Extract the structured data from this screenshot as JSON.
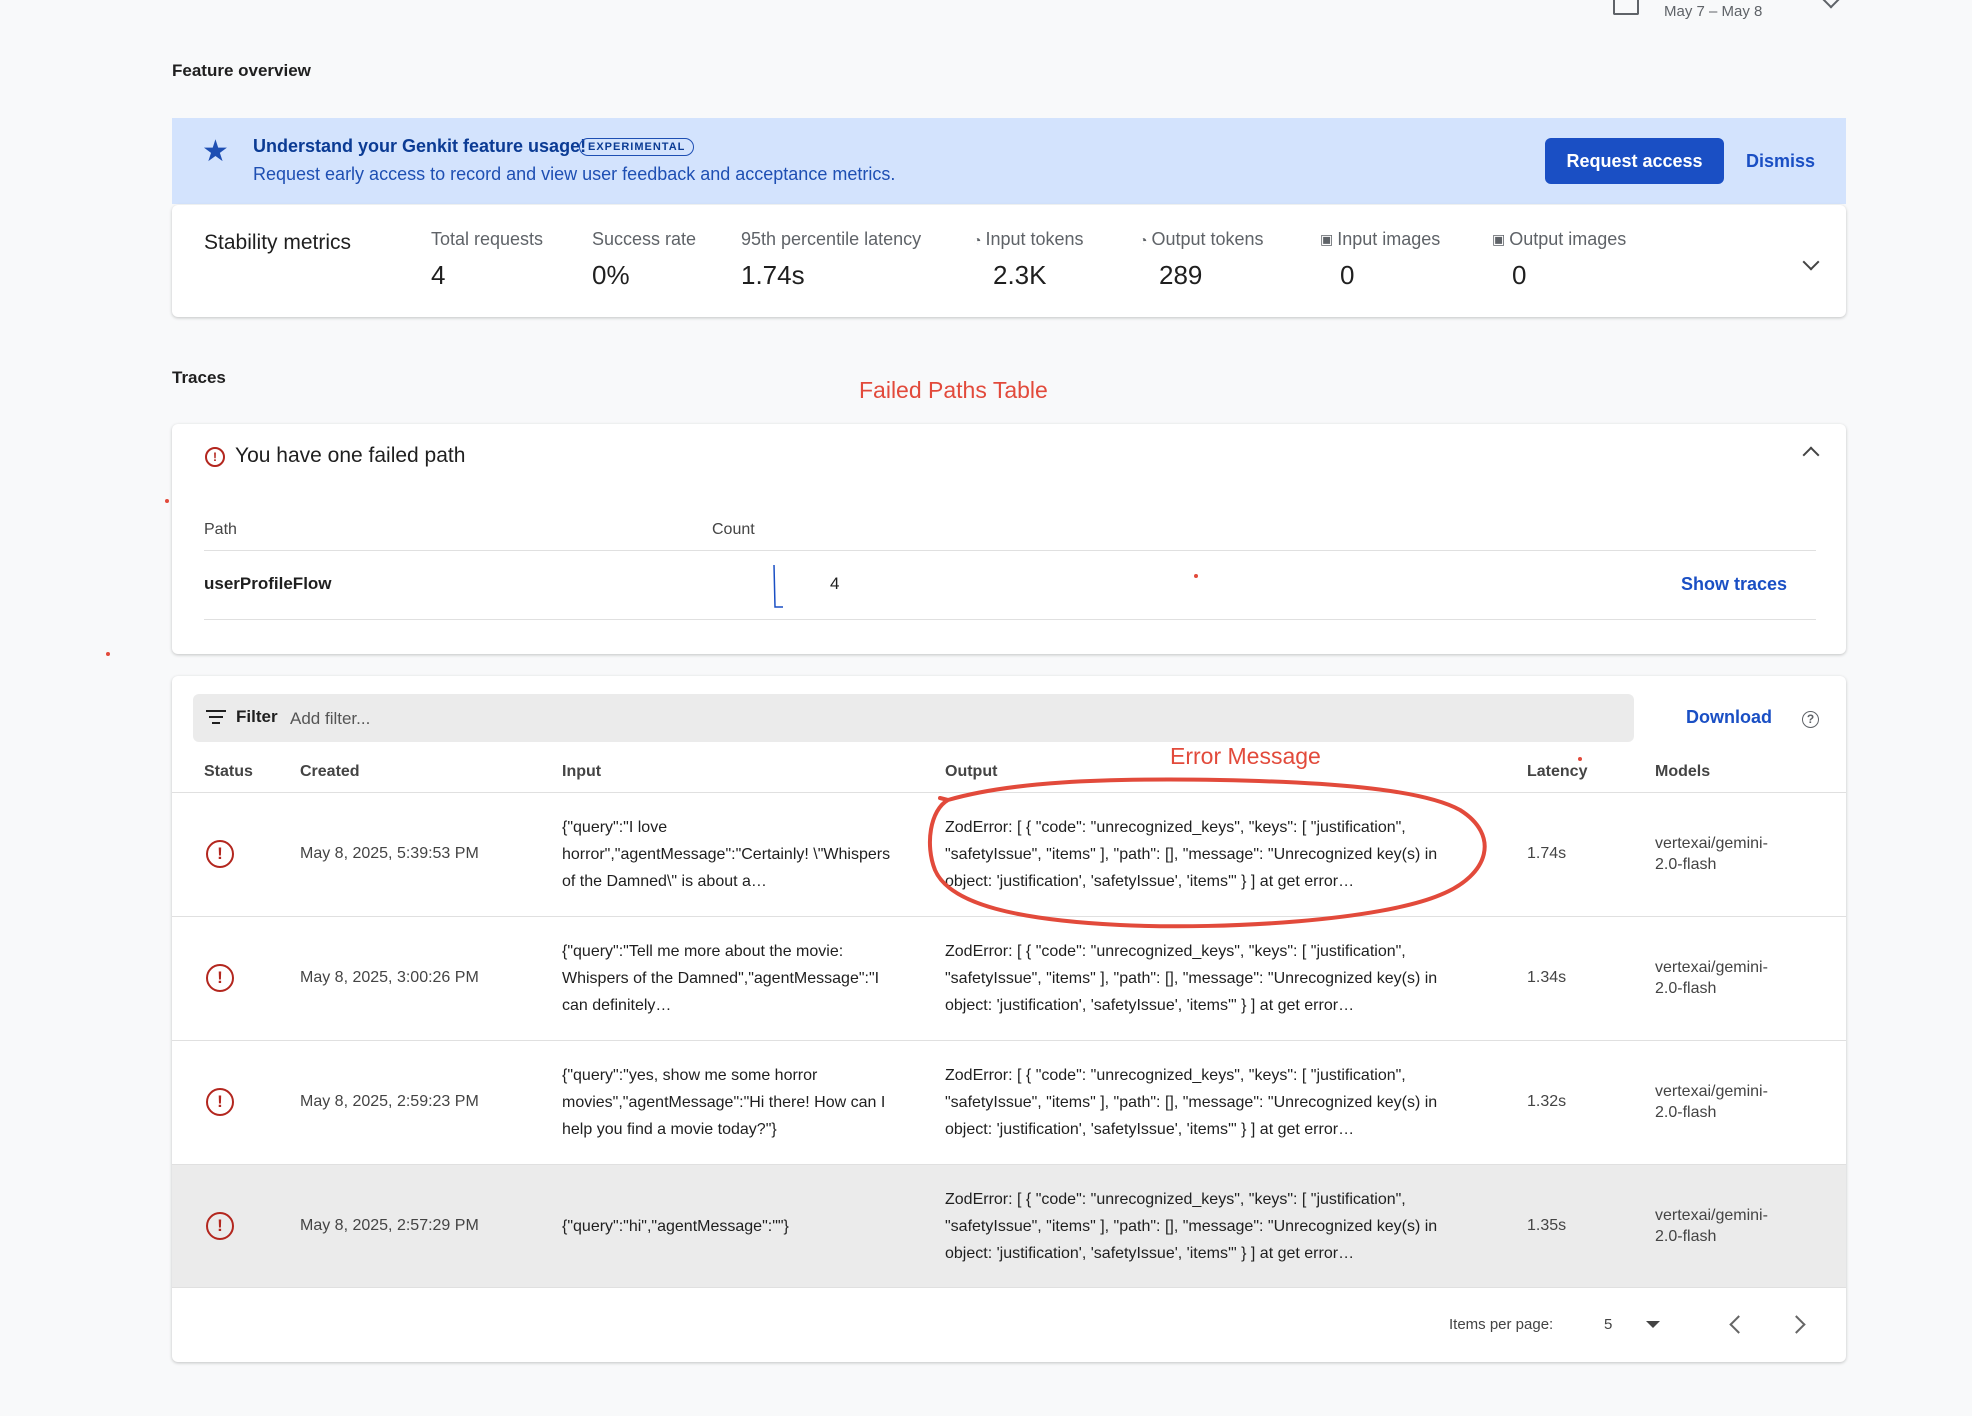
{
  "date_range": {
    "text": "May 7 – May 8"
  },
  "feature_overview": {
    "title": "Feature overview"
  },
  "banner": {
    "title": "Understand your Genkit feature usage!",
    "badge": "EXPERIMENTAL",
    "subtitle": "Request early access to record and view user feedback and acceptance metrics.",
    "request_label": "Request access",
    "dismiss_label": "Dismiss"
  },
  "stability": {
    "title": "Stability metrics",
    "metrics": [
      {
        "label": "Total requests",
        "value": "4",
        "icon": ""
      },
      {
        "label": "Success rate",
        "value": "0%",
        "icon": ""
      },
      {
        "label": "95th percentile latency",
        "value": "1.74s",
        "icon": ""
      },
      {
        "label": "Input tokens",
        "value": "2.3K",
        "icon": "token-icon"
      },
      {
        "label": "Output tokens",
        "value": "289",
        "icon": "token-icon"
      },
      {
        "label": "Input images",
        "value": "0",
        "icon": "image-icon"
      },
      {
        "label": "Output images",
        "value": "0",
        "icon": "image-icon"
      }
    ]
  },
  "traces": {
    "title": "Traces"
  },
  "annotations": {
    "failed_paths": "Failed Paths Table",
    "error_message": "Error Message"
  },
  "failed_paths": {
    "title": "You have one failed path",
    "col_path": "Path",
    "col_count": "Count",
    "rows": [
      {
        "path": "userProfileFlow",
        "count": "4",
        "action": "Show traces"
      }
    ]
  },
  "traces_table": {
    "filter_label": "Filter",
    "filter_placeholder": "Add filter...",
    "download_label": "Download",
    "columns": {
      "status": "Status",
      "created": "Created",
      "input": "Input",
      "output": "Output",
      "latency": "Latency",
      "models": "Models"
    },
    "rows": [
      {
        "created": "May 8, 2025, 5:39:53 PM",
        "input": "{\"query\":\"I love horror\",\"agentMessage\":\"Certainly! \\\"Whispers of the Damned\\\" is about a…",
        "output": "ZodError: [ { \"code\": \"unrecognized_keys\", \"keys\": [ \"justification\", \"safetyIssue\", \"items\" ], \"path\": [], \"message\": \"Unrecognized key(s) in object: 'justification', 'safetyIssue', 'items'\" } ] at get error…",
        "latency": "1.74s",
        "model": "vertexai/gemini-2.0-flash"
      },
      {
        "created": "May 8, 2025, 3:00:26 PM",
        "input": "{\"query\":\"Tell me more about the movie: Whispers of the Damned\",\"agentMessage\":\"I can definitely…",
        "output": "ZodError: [ { \"code\": \"unrecognized_keys\", \"keys\": [ \"justification\", \"safetyIssue\", \"items\" ], \"path\": [], \"message\": \"Unrecognized key(s) in object: 'justification', 'safetyIssue', 'items'\" } ] at get error…",
        "latency": "1.34s",
        "model": "vertexai/gemini-2.0-flash"
      },
      {
        "created": "May 8, 2025, 2:59:23 PM",
        "input": "{\"query\":\"yes, show me some horror movies\",\"agentMessage\":\"Hi there! How can I help you find a movie today?\"}",
        "output": "ZodError: [ { \"code\": \"unrecognized_keys\", \"keys\": [ \"justification\", \"safetyIssue\", \"items\" ], \"path\": [], \"message\": \"Unrecognized key(s) in object: 'justification', 'safetyIssue', 'items'\" } ] at get error…",
        "latency": "1.32s",
        "model": "vertexai/gemini-2.0-flash"
      },
      {
        "created": "May 8, 2025, 2:57:29 PM",
        "input": "{\"query\":\"hi\",\"agentMessage\":\"\"}",
        "output": "ZodError: [ { \"code\": \"unrecognized_keys\", \"keys\": [ \"justification\", \"safetyIssue\", \"items\" ], \"path\": [], \"message\": \"Unrecognized key(s) in object: 'justification', 'safetyIssue', 'items'\" } ] at get error…",
        "latency": "1.35s",
        "model": "vertexai/gemini-2.0-flash"
      }
    ],
    "pager": {
      "label": "Items per page:",
      "value": "5"
    }
  },
  "colors": {
    "accent": "#1a4fc4",
    "banner_bg": "#d3e3fd",
    "error": "#b3261e",
    "annotation": "#e24a3b"
  }
}
